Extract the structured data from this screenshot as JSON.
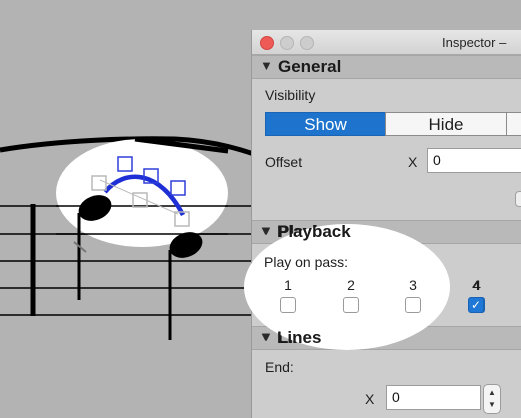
{
  "inspector": {
    "title": "Inspector –",
    "general": {
      "header": "General",
      "visibility_label": "Visibility",
      "show_label": "Show",
      "hide_label": "Hide",
      "offset_label": "Offset",
      "x_label": "X",
      "offset_x_value": "0"
    },
    "playback": {
      "header": "Playback",
      "play_on_pass_label": "Play on pass:",
      "passes": [
        {
          "number": "1",
          "checked": false
        },
        {
          "number": "2",
          "checked": false
        },
        {
          "number": "3",
          "checked": false
        },
        {
          "number": "4",
          "checked": true
        }
      ]
    },
    "lines": {
      "header": "Lines",
      "end_label": "End:",
      "x_label": "X",
      "end_x_value": "0"
    }
  },
  "colors": {
    "accent": "#1e73cc",
    "slur_selected": "#1f2fd6",
    "window_close": "#ee5b57",
    "highlight": "#ffffff"
  }
}
